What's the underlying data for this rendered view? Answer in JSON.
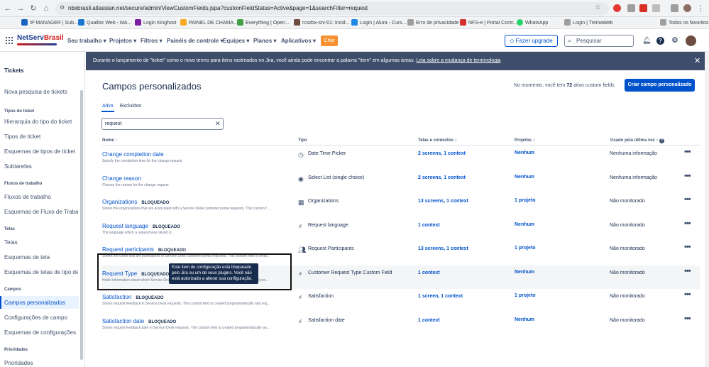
{
  "browser": {
    "url": "nbxbrasil.atlassian.net/secure/admin/ViewCustomFields.jspa?customFieldStatus=Active&page=1&searchFilter=request",
    "bookmarks": [
      "IP MANAGER | Sub...",
      "Qualitor Web - MA...",
      "Login Kinghost",
      "PAINEL DE CHAMA...",
      "Everything | Open...",
      "rcxzbx-srv-01: Incid...",
      "Login | Alura - Curs...",
      "Erro de privacidade",
      "NFS-e | Portal Contr...",
      "WhatsApp",
      "Login | TreinaWeb"
    ],
    "all_bookmarks": "Todos os favoritos"
  },
  "header": {
    "logo_a": "NetServ",
    "logo_b": "Brasil",
    "menu": [
      "Seu trabalho ▾",
      "Projetos ▾",
      "Filtros ▾",
      "Painéis de controle ▾",
      "Equipes ▾",
      "Planos ▾",
      "Aplicativos ▾"
    ],
    "create": "Criar",
    "upgrade": "Fazer upgrade",
    "search_placeholder": "Pesquisar"
  },
  "sidebar": {
    "title": "Tickets",
    "items": [
      {
        "type": "item",
        "label": "Nova pesquisa de tickets"
      },
      {
        "type": "group",
        "label": "Tipos do ticket"
      },
      {
        "type": "item",
        "label": "Hierarquia do tipo do ticket"
      },
      {
        "type": "item",
        "label": "Tipos de ticket"
      },
      {
        "type": "item",
        "label": "Esquemas de tipos de ticket"
      },
      {
        "type": "item",
        "label": "Subtarefas"
      },
      {
        "type": "group",
        "label": "Fluxos de trabalho"
      },
      {
        "type": "item",
        "label": "Fluxos de trabalho"
      },
      {
        "type": "item",
        "label": "Esquemas de Fluxo de Trabal..."
      },
      {
        "type": "group",
        "label": "Telas"
      },
      {
        "type": "item",
        "label": "Telas"
      },
      {
        "type": "item",
        "label": "Esquemas de tela"
      },
      {
        "type": "item",
        "label": "Esquemas de telas de tipo de..."
      },
      {
        "type": "group",
        "label": "Campos"
      },
      {
        "type": "item",
        "label": "Campos personalizados"
      },
      {
        "type": "item",
        "label": "Configurações de campo"
      },
      {
        "type": "item",
        "label": "Esquemas de configurações ..."
      },
      {
        "type": "group",
        "label": "Prioridades"
      },
      {
        "type": "item",
        "label": "Prioridades"
      }
    ]
  },
  "banner": {
    "text": "Durante o lançamento de \"ticket\" como o novo termo para itens rastreados no Jira, você ainda pode encontrar a palavra \"item\" em algumas áreas.",
    "link": "Leia sobre a mudança de terminologia"
  },
  "main": {
    "title": "Campos personalizados",
    "count_prefix": "No momento, você tem",
    "count": "72",
    "count_suffix": "ativo custom fields",
    "create_button": "Criar campo personalizado",
    "tabs": [
      "Ativo",
      "Excluídos"
    ],
    "filter_value": "request",
    "columns": [
      "Nome ↑",
      "Tipo",
      "Telas e contextos ↕",
      "Projetos ↕",
      "Usado pela última vez ↕"
    ],
    "lock_label": "BLOQUEADO",
    "tooltip": "Este item de configuração está bloqueado pelo Jira ou um de seus plugins. Você não está autorizado a alterar sua configuração.",
    "rows": [
      {
        "name": "Change completion date",
        "locked": false,
        "desc": "Specify the completion time for the change request",
        "type": "Date Time Picker",
        "icon": "clock-icon",
        "screens": "2 screens,  1 context",
        "projects": "Nenhum",
        "last": "Nenhuma informação"
      },
      {
        "name": "Change reason",
        "locked": false,
        "desc": "Choose the reason for the change request",
        "type": "Select List (single choice)",
        "icon": "select-icon",
        "screens": "2 screens,  1 context",
        "projects": "Nenhum",
        "last": "Nenhuma informação"
      },
      {
        "name": "Organizations",
        "locked": true,
        "desc": "Stores the organizations that are associated with a Service Desk customer portal requests. This custom f...",
        "type": "Organizations",
        "icon": "building-icon",
        "screens": "13 screens,  1 context",
        "projects": "1 projeto",
        "last": "Não monitorado"
      },
      {
        "name": "Request language",
        "locked": true,
        "desc": "The language which a request was raised in.",
        "type": "Request language",
        "icon": "bolt-icon",
        "screens": "1 context",
        "projects": "Nenhum",
        "last": "Não monitorado"
      },
      {
        "name": "Request participants",
        "locked": true,
        "desc": "Stores the users that are participants in Service Desk customer portal requests. This custom field is creat...",
        "type": "Request Participants",
        "icon": "people-icon",
        "screens": "13 screens,  1 context",
        "projects": "1 projeto",
        "last": "Não monitorado"
      },
      {
        "name": "Request Type",
        "locked": true,
        "desc": "Holds information about which Service Desk was used to create a ticket. This custom field is created pro...",
        "type": "Customer Request Type Custom Field",
        "icon": "bolt-icon",
        "screens": "1 context",
        "projects": "Nenhum",
        "last": "Não monitorado"
      },
      {
        "name": "Satisfaction",
        "locked": true,
        "desc": "Stores request feedback in Service Desk requests. This custom field is created programmatically and req...",
        "type": "Satisfaction",
        "icon": "bolt-icon",
        "screens": "1 screen,  1 context",
        "projects": "1 projeto",
        "last": "Não monitorado"
      },
      {
        "name": "Satisfaction date",
        "locked": true,
        "desc": "Stores request feedback date in Service Desk requests. This custom field is created programmatically an...",
        "type": "Satisfaction date",
        "icon": "bolt-icon",
        "screens": "1 context",
        "projects": "Nenhum",
        "last": "Não monitorado"
      }
    ]
  }
}
